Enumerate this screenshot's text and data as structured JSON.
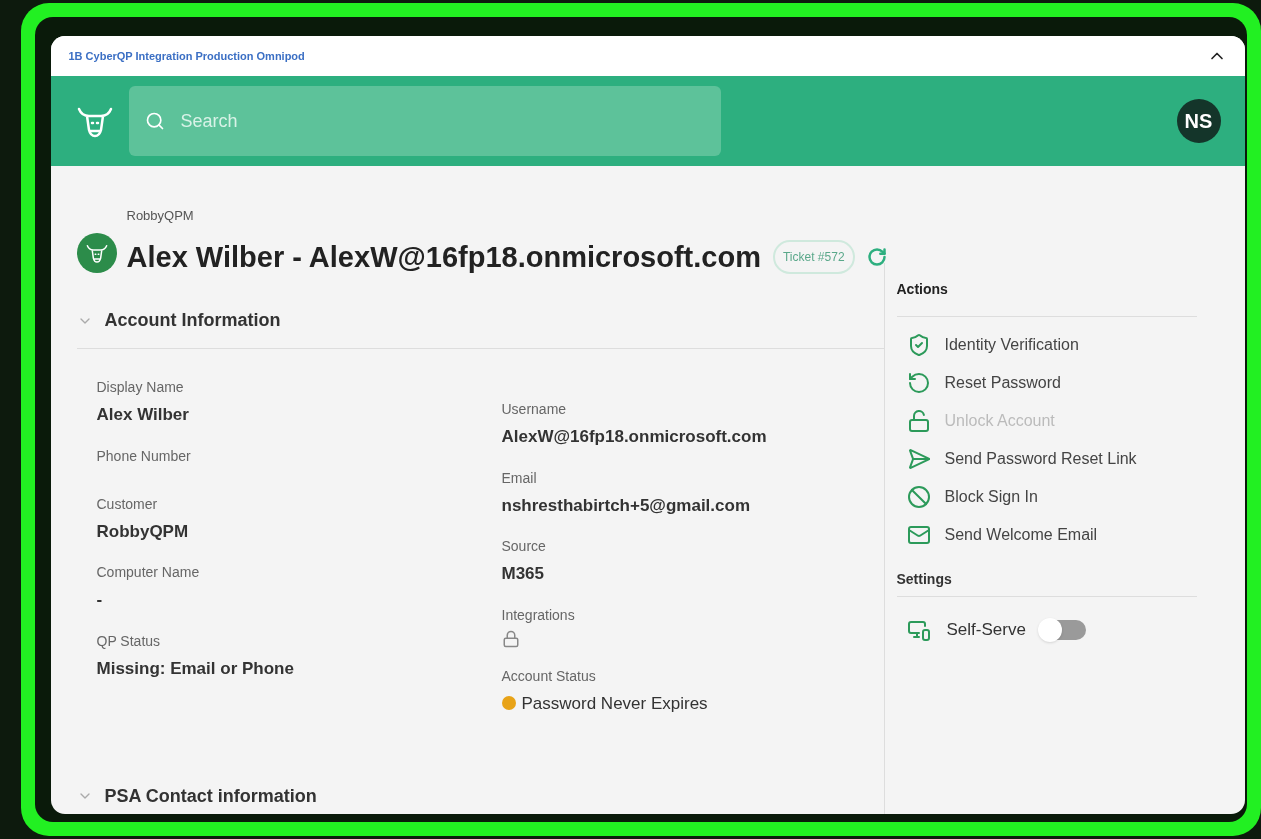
{
  "window": {
    "title": "1B CyberQP Integration Production Omnipod"
  },
  "header": {
    "search": {
      "placeholder": "Search"
    },
    "avatar": "NS"
  },
  "user": {
    "org": "RobbyQPM",
    "title": "Alex Wilber - AlexW@16fp18.onmicrosoft.com",
    "ticket": "Ticket #572"
  },
  "account_section": {
    "title": "Account Information",
    "expanded": true,
    "left_fields": [
      {
        "label": "Display Name",
        "value": "Alex Wilber"
      },
      {
        "label": "Phone Number"
      },
      {
        "label": "Customer",
        "value": "RobbyQPM"
      },
      {
        "label": "Computer Name",
        "value": "-"
      },
      {
        "label": "QP Status",
        "value": "Missing: Email or Phone"
      }
    ],
    "right_fields": [
      {
        "label": "Username",
        "value": "AlexW@16fp18.onmicrosoft.com",
        "kind": "text"
      },
      {
        "label": "Email",
        "value": "nshresthabirtch+5@gmail.com",
        "kind": "text"
      },
      {
        "label": "Source",
        "value": "M365",
        "kind": "text"
      },
      {
        "label": "Integrations",
        "kind": "lock"
      },
      {
        "label": "Account Status",
        "value": "Password Never Expires",
        "kind": "status",
        "color": "#e8a317"
      }
    ]
  },
  "psa_section": {
    "title": "PSA Contact information",
    "expanded": false
  },
  "actions": {
    "title": "Actions",
    "items": [
      {
        "label": "Identity Verification",
        "kind": "identity",
        "disabled": false
      },
      {
        "label": "Reset Password",
        "kind": "reset",
        "disabled": false
      },
      {
        "label": "Unlock Account",
        "kind": "unlock",
        "disabled": true
      },
      {
        "label": "Send Password Reset Link",
        "kind": "send",
        "disabled": false
      },
      {
        "label": "Block Sign In",
        "kind": "block",
        "disabled": false
      },
      {
        "label": "Send Welcome Email",
        "kind": "mail",
        "disabled": false
      }
    ]
  },
  "settings": {
    "title": "Settings",
    "items": [
      {
        "label": "Self-Serve",
        "on": false
      }
    ]
  }
}
